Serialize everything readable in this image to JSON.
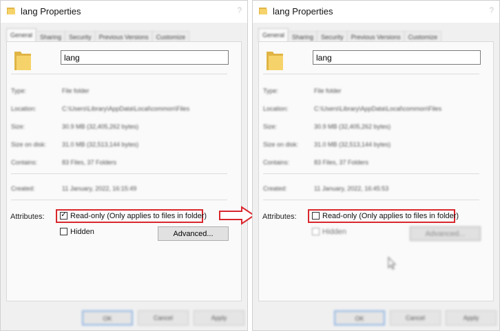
{
  "left": {
    "title": "lang Properties",
    "tabs": [
      "General",
      "Sharing",
      "Security",
      "Previous Versions",
      "Customize"
    ],
    "name_value": "lang",
    "properties": [
      {
        "label": "Type:",
        "value": "File folder"
      },
      {
        "label": "Location:",
        "value": "C:\\Users\\Library\\AppData\\Local\\common\\Files"
      },
      {
        "label": "Size:",
        "value": "30.9 MB (32,405,262 bytes)"
      },
      {
        "label": "Size on disk:",
        "value": "31.0 MB (32,513,144 bytes)"
      },
      {
        "label": "Contains:",
        "value": "83 Files, 37 Folders"
      },
      {
        "label": "Created:",
        "value": "11 January, 2022, 16:15:49"
      }
    ],
    "attributes_label": "Attributes:",
    "readonly_label": "Read-only (Only applies to files in folder)",
    "readonly_checked": true,
    "hidden_label": "Hidden",
    "hidden_checked": false,
    "advanced_label": "Advanced...",
    "buttons": [
      "OK",
      "Cancel",
      "Apply"
    ]
  },
  "right": {
    "title": "lang Properties",
    "tabs": [
      "General",
      "Sharing",
      "Security",
      "Previous Versions",
      "Customize"
    ],
    "name_value": "lang",
    "properties": [
      {
        "label": "Type:",
        "value": "File folder"
      },
      {
        "label": "Location:",
        "value": "C:\\Users\\Library\\AppData\\Local\\common\\Files"
      },
      {
        "label": "Size:",
        "value": "30.9 MB (32,405,262 bytes)"
      },
      {
        "label": "Size on disk:",
        "value": "31.0 MB (32,513,144 bytes)"
      },
      {
        "label": "Contains:",
        "value": "83 Files, 37 Folders"
      },
      {
        "label": "Created:",
        "value": "11 January, 2022, 16:45:53"
      }
    ],
    "attributes_label": "Attributes:",
    "readonly_label": "Read-only (Only applies to files in folder)",
    "readonly_checked": false,
    "hidden_label": "Hidden",
    "hidden_checked": false,
    "advanced_label": "Advanced...",
    "buttons": [
      "OK",
      "Cancel",
      "Apply"
    ]
  },
  "colors": {
    "highlight": "#d9262c",
    "folder": "#f6d36a",
    "dialog_bg": "#f0f0f0"
  }
}
